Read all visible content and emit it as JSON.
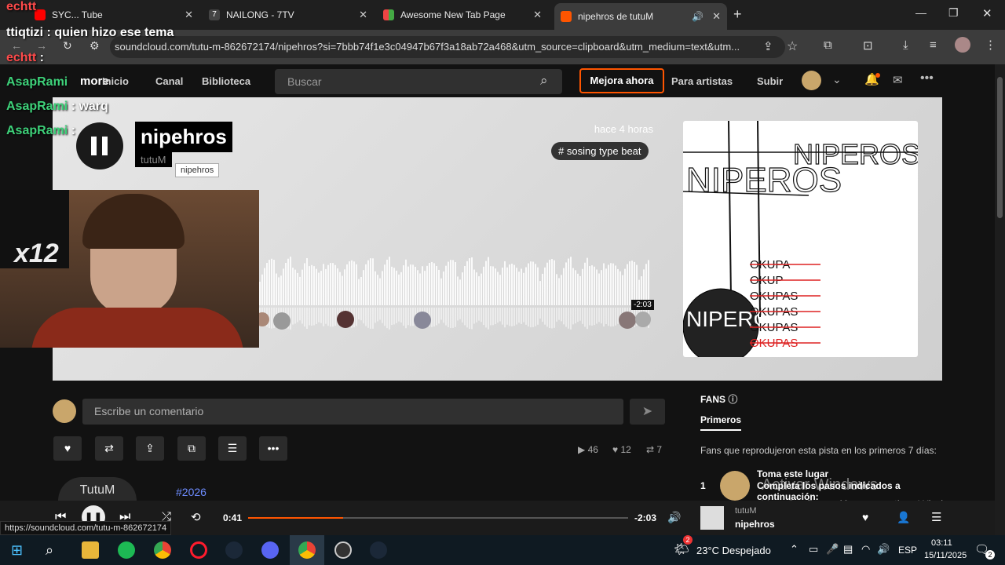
{
  "tabs": [
    {
      "label": "SYC... Tube"
    },
    {
      "label": "NAILONG - 7TV"
    },
    {
      "label": "Awesome New Tab Page"
    },
    {
      "label": "nipehros de tutuM"
    }
  ],
  "address": {
    "url": "soundcloud.com/tutu-m-862672174/nipehros?si=7bbb74f1e3c04947b67f3a18ab72a468&utm_source=clipboard&utm_medium=text&utm..."
  },
  "nav": {
    "more": "more",
    "inicio": "Inicio",
    "canal": "Canal",
    "biblioteca": "Biblioteca",
    "search_placeholder": "Buscar",
    "upgrade": "Mejora ahora",
    "artists": "Para artistas",
    "upload": "Subir"
  },
  "track": {
    "title": "nipehros",
    "artist": "tutuM",
    "tooltip": "nipehros",
    "posted": "hace 4 horas",
    "tag": "# sosing type beat",
    "remaining": "-2:03"
  },
  "art": {
    "text1": "NIPEROS",
    "text2": "NIPEROS",
    "text3": "NIPEROS",
    "list": [
      "OKUPA",
      "OKUP",
      "OKUPAS",
      "OKUPAS",
      "OKUPAS",
      "OKUPAS"
    ]
  },
  "cam_badge": "x12",
  "chat": [
    {
      "name": "echtt",
      "text": ""
    },
    {
      "name": "ttiqtizi",
      "text": "quien hizo ese tema"
    },
    {
      "name": "echtt",
      "text": ""
    },
    {
      "name": "AsapRami",
      "text": ""
    },
    {
      "name": "AsapRami",
      "text": "warq"
    },
    {
      "name": "AsapRami",
      "text": ""
    }
  ],
  "comment_placeholder": "Escribe un comentario",
  "stats": {
    "plays": "46",
    "likes": "12",
    "reposts": "7"
  },
  "fans": {
    "title": "FANS",
    "tab": "Primeros",
    "desc": "Fans que reprodujeron esta pista en los primeros 7 días:",
    "rank": "1",
    "first_name": "Toma este lugar",
    "first_sub": "Completa los pasos indicados a continuación:"
  },
  "watermark": {
    "line1": "Activar Windows",
    "line2": "Ve a Configuración para activar Windows."
  },
  "desc_tag": "#2026",
  "uploader": "TutuM",
  "player": {
    "elapsed": "0:41",
    "remaining": "-2:03",
    "artist": "tutuM",
    "title": "nipehros",
    "progress": 0.25
  },
  "status_url": "https://soundcloud.com/tutu-m-862672174",
  "taskbar": {
    "weather": "23°C  Despejado",
    "lang": "ESP",
    "time": "03:11",
    "date": "15/11/2025",
    "notif": "2"
  },
  "colors": {
    "accent": "#ff5500",
    "bg": "#121212"
  }
}
